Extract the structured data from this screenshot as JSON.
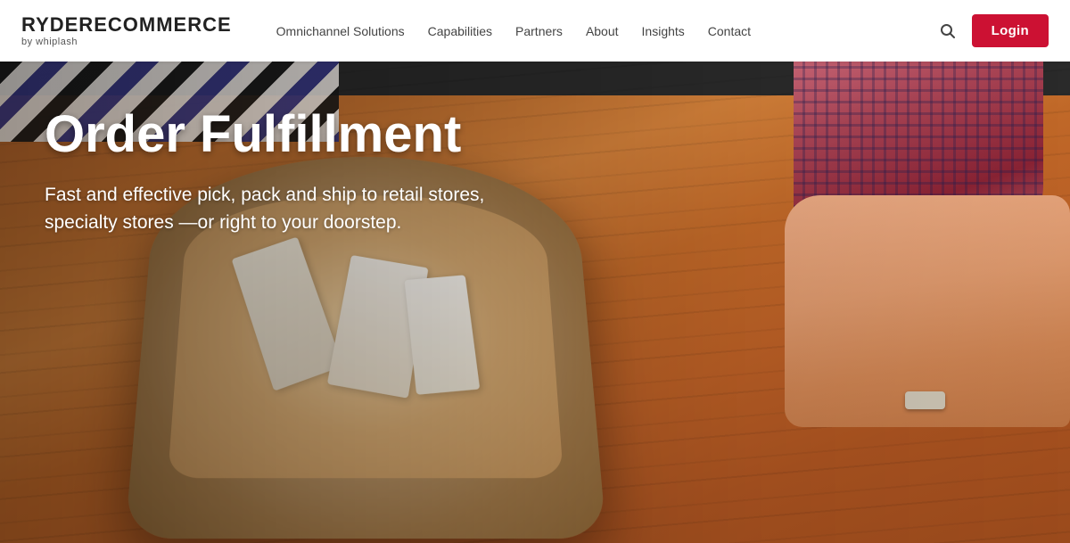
{
  "navbar": {
    "logo": {
      "brand": "RYDER",
      "brand_rest": "ECOMMERCE",
      "sub": "by whiplash"
    },
    "links": [
      {
        "id": "omnichannel",
        "label": "Omnichannel Solutions"
      },
      {
        "id": "capabilities",
        "label": "Capabilities"
      },
      {
        "id": "partners",
        "label": "Partners"
      },
      {
        "id": "about",
        "label": "About"
      },
      {
        "id": "insights",
        "label": "Insights"
      },
      {
        "id": "contact",
        "label": "Contact"
      }
    ],
    "login_label": "Login"
  },
  "hero": {
    "title": "Order Fulfillment",
    "subtitle": "Fast and effective pick, pack and ship to retail stores, specialty stores —or right to your doorstep."
  },
  "colors": {
    "brand_red": "#cc1133",
    "nav_bg": "#ffffff",
    "hero_text": "#ffffff"
  }
}
